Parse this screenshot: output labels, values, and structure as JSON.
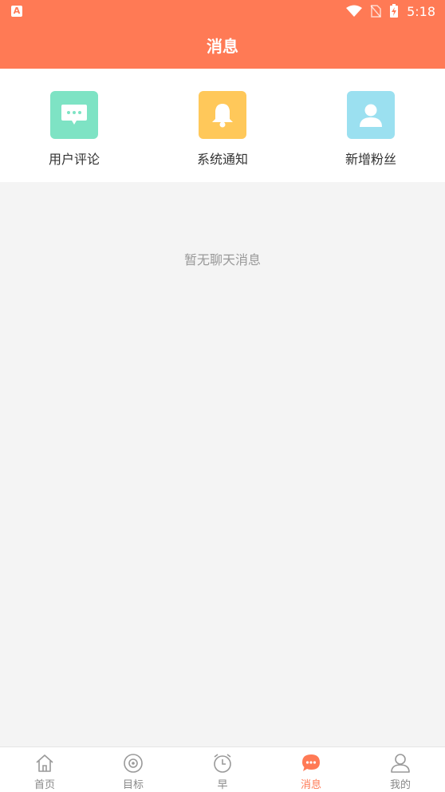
{
  "status_bar": {
    "app_badge": "A",
    "time": "5:18"
  },
  "header": {
    "title": "消息"
  },
  "categories": [
    {
      "label": "用户评论",
      "icon": "comment-icon",
      "color": "#7ee3c4"
    },
    {
      "label": "系统通知",
      "icon": "bell-icon",
      "color": "#ffc85a"
    },
    {
      "label": "新增粉丝",
      "icon": "user-icon",
      "color": "#9be0f0"
    }
  ],
  "empty_state": {
    "text": "暂无聊天消息"
  },
  "tab_bar": {
    "items": [
      {
        "label": "首页",
        "icon": "home-icon"
      },
      {
        "label": "目标",
        "icon": "target-icon"
      },
      {
        "label": "早",
        "icon": "alarm-clock-icon"
      },
      {
        "label": "消息",
        "icon": "chat-icon",
        "active": true
      },
      {
        "label": "我的",
        "icon": "profile-icon"
      }
    ],
    "accent_color": "#ff7a55"
  }
}
